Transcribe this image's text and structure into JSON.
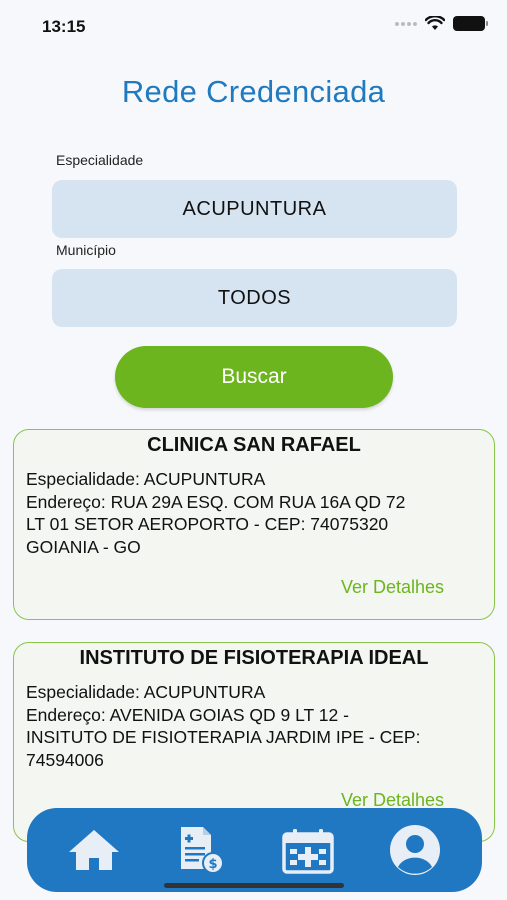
{
  "status_bar": {
    "time": "13:15"
  },
  "header": {
    "title": "Rede Credenciada"
  },
  "filters": {
    "specialty_label": "Especialidade",
    "specialty_value": "ACUPUNTURA",
    "city_label": "Município",
    "city_value": "TODOS"
  },
  "search_button": {
    "label": "Buscar"
  },
  "results": [
    {
      "name": "CLINICA SAN RAFAEL",
      "specialty_line": "Especialidade: ACUPUNTURA",
      "address_line_1": "Endereço: RUA 29A ESQ. COM RUA 16A QD 72",
      "address_line_2": "LT 01 SETOR AEROPORTO - CEP: 74075320",
      "address_line_3": "GOIANIA - GO",
      "details_link": "Ver Detalhes"
    },
    {
      "name": "INSTITUTO DE FISIOTERAPIA IDEAL",
      "specialty_line": "Especialidade: ACUPUNTURA",
      "address_line_1": "Endereço: AVENIDA GOIAS QD 9 LT 12 -",
      "address_line_2": "INSITUTO DE FISIOTERAPIA JARDIM IPE - CEP:",
      "address_line_3": "74594006",
      "details_link": "Ver Detalhes"
    }
  ],
  "bottom_nav": {
    "items": [
      {
        "icon": "home-icon"
      },
      {
        "icon": "invoice-icon"
      },
      {
        "icon": "medical-calendar-icon"
      },
      {
        "icon": "profile-icon"
      }
    ]
  },
  "colors": {
    "title_blue": "#1f7ac0",
    "field_background": "#d6e4f2",
    "accent_green": "#6cb51e",
    "nav_blue": "#2078c2"
  }
}
